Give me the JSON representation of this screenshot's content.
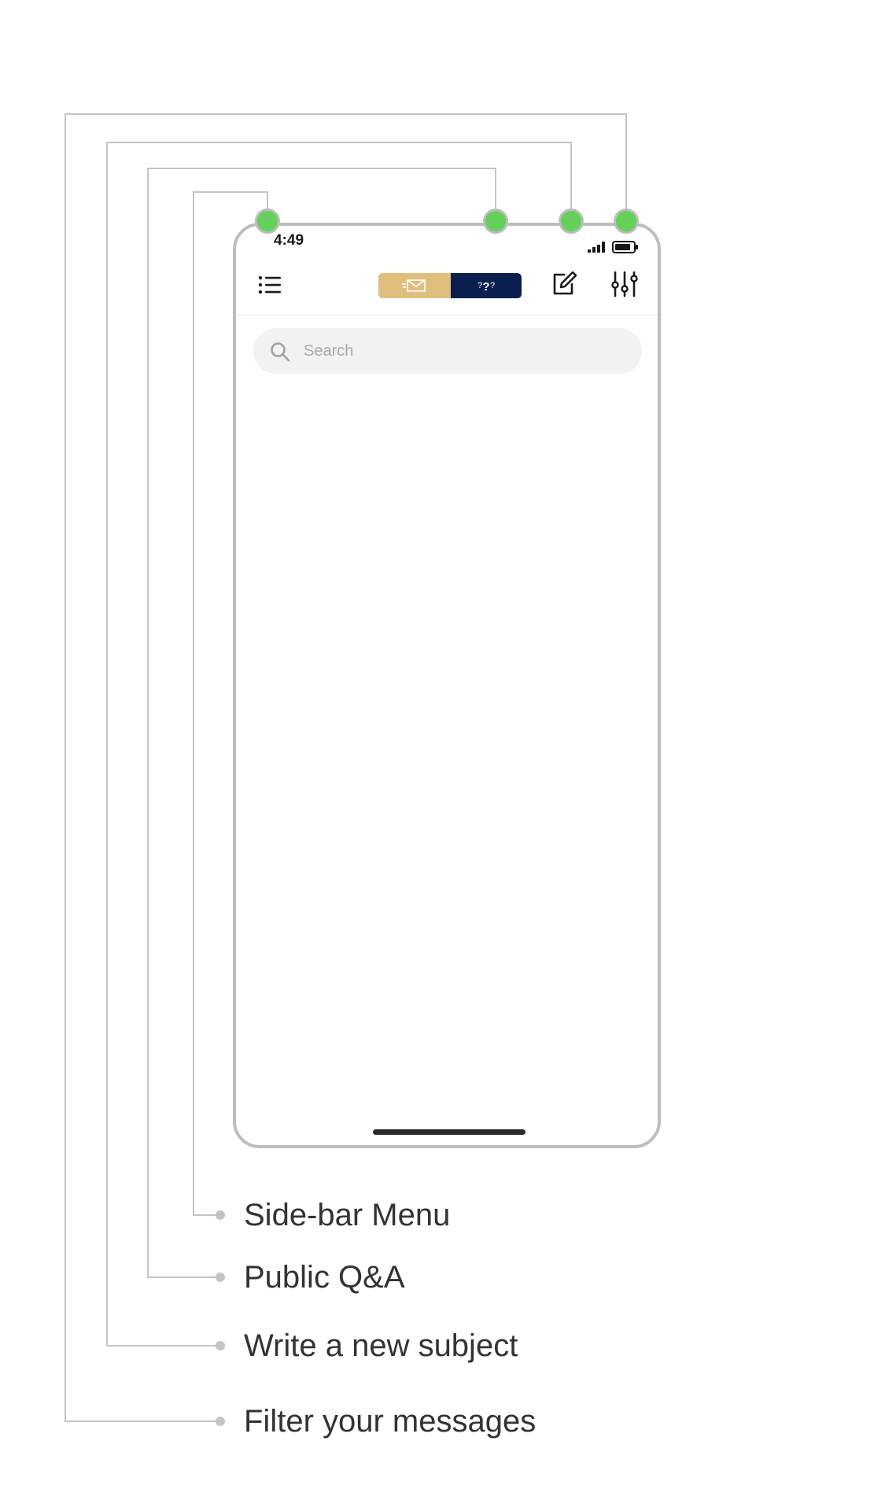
{
  "status_bar": {
    "time": "4:49",
    "signal_icon": "cellular-signal-icon",
    "battery_icon": "battery-icon"
  },
  "toolbar": {
    "menu_icon": "list-icon",
    "segments": [
      {
        "name": "messages",
        "icon": "envelope-icon",
        "selected": true
      },
      {
        "name": "public-qa",
        "icon": "question-marks-icon",
        "selected": false
      }
    ],
    "compose_icon": "compose-icon",
    "filter_icon": "sliders-icon"
  },
  "search": {
    "placeholder": "Search",
    "value": ""
  },
  "legend": {
    "items": [
      {
        "label": "Side-bar Menu"
      },
      {
        "label": "Public Q&A"
      },
      {
        "label": "Write a new subject"
      },
      {
        "label": "Filter your messages"
      }
    ]
  },
  "colors": {
    "accent_gold": "#e0bf7e",
    "navy": "#0a1f4d",
    "callout_green": "#63d15a",
    "frame_gray": "#bdbdbd"
  }
}
